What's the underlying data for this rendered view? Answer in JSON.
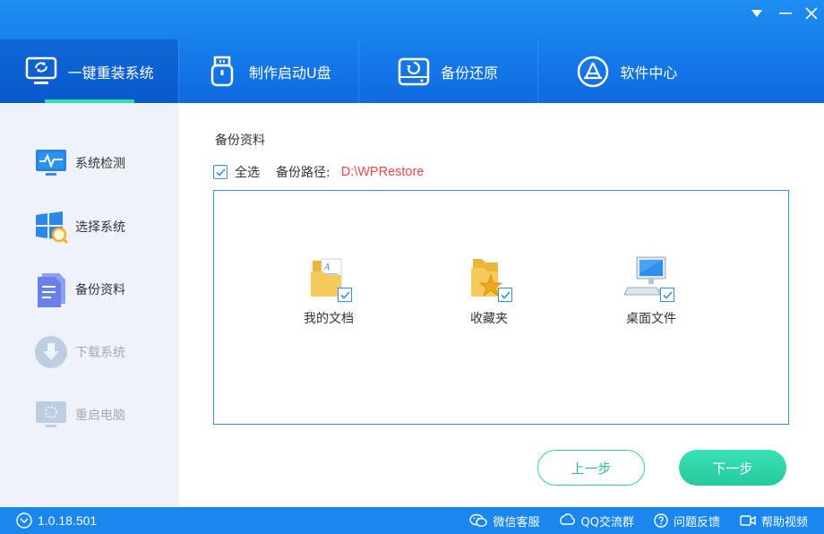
{
  "window": {
    "minimize_icon": "triangle-down-icon",
    "restore_icon": "minus-icon",
    "close_icon": "close-icon"
  },
  "nav": {
    "tabs": [
      {
        "label": "一键重装系统",
        "icon": "monitor-refresh-icon",
        "active": true
      },
      {
        "label": "制作启动U盘",
        "icon": "usb-drive-icon",
        "active": false
      },
      {
        "label": "备份还原",
        "icon": "disk-restore-icon",
        "active": false
      },
      {
        "label": "软件中心",
        "icon": "app-store-icon",
        "active": false
      }
    ]
  },
  "sidebar": {
    "items": [
      {
        "label": "系统检测",
        "icon": "monitor-pulse-icon",
        "enabled": true
      },
      {
        "label": "选择系统",
        "icon": "windows-search-icon",
        "enabled": true
      },
      {
        "label": "备份资料",
        "icon": "document-icon",
        "enabled": true
      },
      {
        "label": "下载系统",
        "icon": "download-icon",
        "enabled": false
      },
      {
        "label": "重启电脑",
        "icon": "restart-monitor-icon",
        "enabled": false
      }
    ]
  },
  "main": {
    "title": "备份资料",
    "select_all_label": "全选",
    "select_all_checked": true,
    "path_label": "备份路径:",
    "path_value": "D:\\WPRestore",
    "items": [
      {
        "label": "我的文档",
        "icon": "documents-folder-icon",
        "checked": true
      },
      {
        "label": "收藏夹",
        "icon": "favorites-folder-icon",
        "checked": true
      },
      {
        "label": "桌面文件",
        "icon": "desktop-computer-icon",
        "checked": true
      }
    ],
    "prev_label": "上一步",
    "next_label": "下一步"
  },
  "status": {
    "version": "1.0.18.501",
    "links": [
      {
        "label": "微信客服",
        "icon": "wechat-icon"
      },
      {
        "label": "QQ交流群",
        "icon": "qq-icon"
      },
      {
        "label": "问题反馈",
        "icon": "question-icon"
      },
      {
        "label": "帮助视频",
        "icon": "video-icon"
      }
    ]
  },
  "colors": {
    "header_blue": "#1478e8",
    "accent_green": "#2fe0b0",
    "path_red": "#f04848",
    "sidebar_bg": "#eef3fb"
  }
}
